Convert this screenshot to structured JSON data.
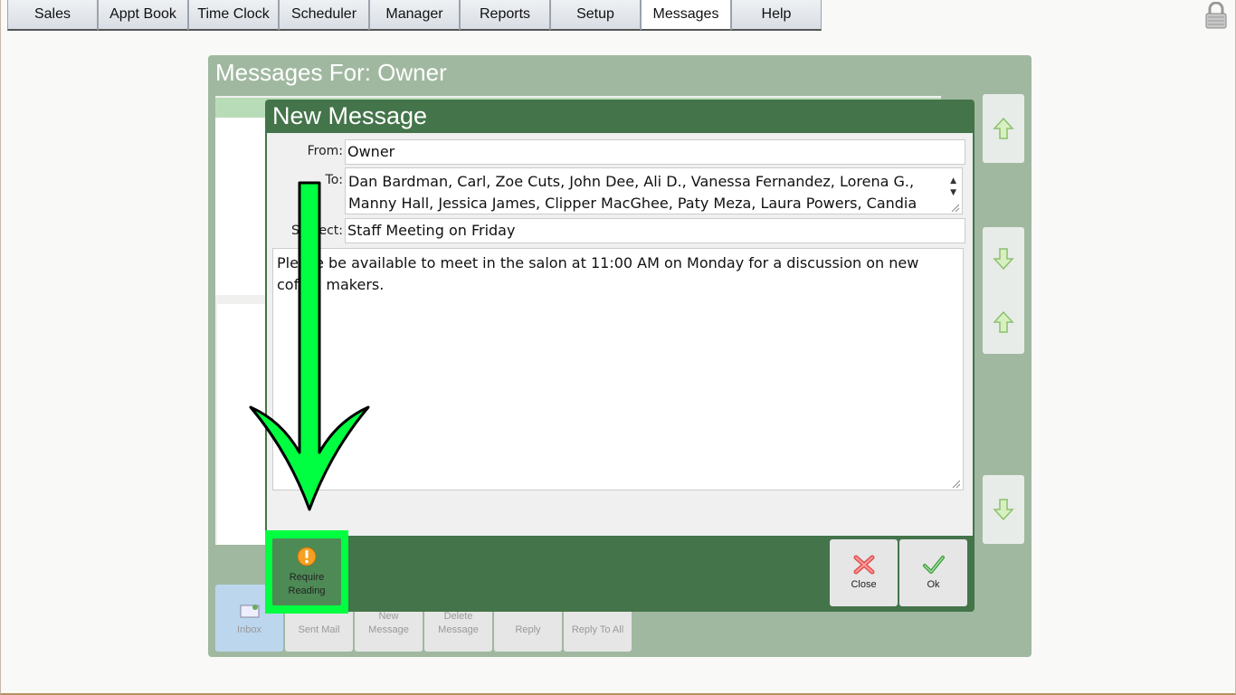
{
  "nav": {
    "tabs": [
      "Sales",
      "Appt Book",
      "Time Clock",
      "Scheduler",
      "Manager",
      "Reports",
      "Setup",
      "Messages",
      "Help"
    ],
    "active_tab": "Messages"
  },
  "panel": {
    "title": "Messages For: Owner"
  },
  "toolbar": {
    "inbox": "Inbox",
    "sent_mail": "Sent Mail",
    "new_message_1": "New",
    "new_message_2": "Message",
    "delete_message_1": "Delete",
    "delete_message_2": "Message",
    "reply": "Reply",
    "reply_to_all": "Reply To All"
  },
  "dialog": {
    "title": "New Message",
    "from_label": "From:",
    "from_value": "Owner",
    "to_label": "To:",
    "to_value": "Dan Bardman, Carl, Zoe Cuts, John Dee, Ali D., Vanessa Fernandez, Lorena G., Manny Hall, Jessica James, Clipper MacGhee, Paty Meza, Laura Powers, Candia",
    "subject_label": "Subject:",
    "subject_value": "Staff Meeting on Friday",
    "body": "Please be available to meet in the salon at 11:00 AM on Monday for a discussion on new coffee makers.",
    "require_reading_1": "Require",
    "require_reading_2": "Reading",
    "close_label": "Close",
    "ok_label": "Ok"
  },
  "colors": {
    "dialog_green": "#44744a",
    "panel_green": "#a0b8a0",
    "highlight": "#00ff40"
  },
  "icons": [
    "lock-icon",
    "up-arrow-icon",
    "down-arrow-icon",
    "close-x-icon",
    "ok-check-icon",
    "warning-icon",
    "pointer-arrow"
  ]
}
